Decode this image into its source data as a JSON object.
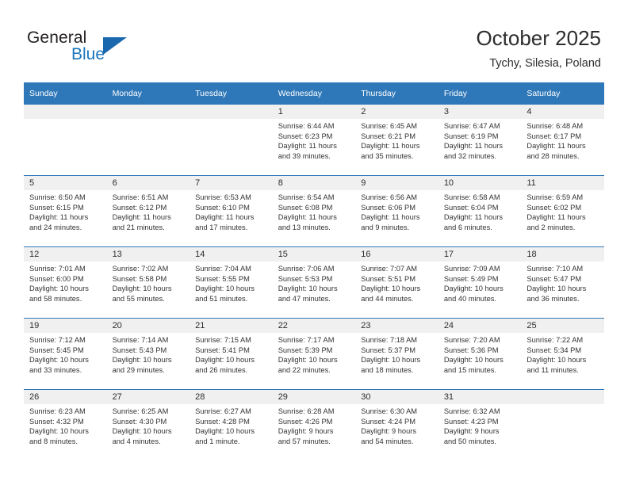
{
  "brand": {
    "word_one": "General",
    "word_two": "Blue",
    "triangle_color": "#1b68ae"
  },
  "header": {
    "title": "October 2025",
    "location": "Tychy, Silesia, Poland"
  },
  "theme": {
    "header_blue": "#2e77b8",
    "band_gray": "#f0f0f0",
    "text": "#333333"
  },
  "weekday_headers": [
    "Sunday",
    "Monday",
    "Tuesday",
    "Wednesday",
    "Thursday",
    "Friday",
    "Saturday"
  ],
  "weeks": [
    [
      {
        "day": "",
        "sunrise": "",
        "sunset": "",
        "daylight_1": "",
        "daylight_2": "",
        "empty": true
      },
      {
        "day": "",
        "sunrise": "",
        "sunset": "",
        "daylight_1": "",
        "daylight_2": "",
        "empty": true
      },
      {
        "day": "",
        "sunrise": "",
        "sunset": "",
        "daylight_1": "",
        "daylight_2": "",
        "empty": true
      },
      {
        "day": "1",
        "sunrise": "Sunrise: 6:44 AM",
        "sunset": "Sunset: 6:23 PM",
        "daylight_1": "Daylight: 11 hours",
        "daylight_2": "and 39 minutes."
      },
      {
        "day": "2",
        "sunrise": "Sunrise: 6:45 AM",
        "sunset": "Sunset: 6:21 PM",
        "daylight_1": "Daylight: 11 hours",
        "daylight_2": "and 35 minutes."
      },
      {
        "day": "3",
        "sunrise": "Sunrise: 6:47 AM",
        "sunset": "Sunset: 6:19 PM",
        "daylight_1": "Daylight: 11 hours",
        "daylight_2": "and 32 minutes."
      },
      {
        "day": "4",
        "sunrise": "Sunrise: 6:48 AM",
        "sunset": "Sunset: 6:17 PM",
        "daylight_1": "Daylight: 11 hours",
        "daylight_2": "and 28 minutes."
      }
    ],
    [
      {
        "day": "5",
        "sunrise": "Sunrise: 6:50 AM",
        "sunset": "Sunset: 6:15 PM",
        "daylight_1": "Daylight: 11 hours",
        "daylight_2": "and 24 minutes."
      },
      {
        "day": "6",
        "sunrise": "Sunrise: 6:51 AM",
        "sunset": "Sunset: 6:12 PM",
        "daylight_1": "Daylight: 11 hours",
        "daylight_2": "and 21 minutes."
      },
      {
        "day": "7",
        "sunrise": "Sunrise: 6:53 AM",
        "sunset": "Sunset: 6:10 PM",
        "daylight_1": "Daylight: 11 hours",
        "daylight_2": "and 17 minutes."
      },
      {
        "day": "8",
        "sunrise": "Sunrise: 6:54 AM",
        "sunset": "Sunset: 6:08 PM",
        "daylight_1": "Daylight: 11 hours",
        "daylight_2": "and 13 minutes."
      },
      {
        "day": "9",
        "sunrise": "Sunrise: 6:56 AM",
        "sunset": "Sunset: 6:06 PM",
        "daylight_1": "Daylight: 11 hours",
        "daylight_2": "and 9 minutes."
      },
      {
        "day": "10",
        "sunrise": "Sunrise: 6:58 AM",
        "sunset": "Sunset: 6:04 PM",
        "daylight_1": "Daylight: 11 hours",
        "daylight_2": "and 6 minutes."
      },
      {
        "day": "11",
        "sunrise": "Sunrise: 6:59 AM",
        "sunset": "Sunset: 6:02 PM",
        "daylight_1": "Daylight: 11 hours",
        "daylight_2": "and 2 minutes."
      }
    ],
    [
      {
        "day": "12",
        "sunrise": "Sunrise: 7:01 AM",
        "sunset": "Sunset: 6:00 PM",
        "daylight_1": "Daylight: 10 hours",
        "daylight_2": "and 58 minutes."
      },
      {
        "day": "13",
        "sunrise": "Sunrise: 7:02 AM",
        "sunset": "Sunset: 5:58 PM",
        "daylight_1": "Daylight: 10 hours",
        "daylight_2": "and 55 minutes."
      },
      {
        "day": "14",
        "sunrise": "Sunrise: 7:04 AM",
        "sunset": "Sunset: 5:55 PM",
        "daylight_1": "Daylight: 10 hours",
        "daylight_2": "and 51 minutes."
      },
      {
        "day": "15",
        "sunrise": "Sunrise: 7:06 AM",
        "sunset": "Sunset: 5:53 PM",
        "daylight_1": "Daylight: 10 hours",
        "daylight_2": "and 47 minutes."
      },
      {
        "day": "16",
        "sunrise": "Sunrise: 7:07 AM",
        "sunset": "Sunset: 5:51 PM",
        "daylight_1": "Daylight: 10 hours",
        "daylight_2": "and 44 minutes."
      },
      {
        "day": "17",
        "sunrise": "Sunrise: 7:09 AM",
        "sunset": "Sunset: 5:49 PM",
        "daylight_1": "Daylight: 10 hours",
        "daylight_2": "and 40 minutes."
      },
      {
        "day": "18",
        "sunrise": "Sunrise: 7:10 AM",
        "sunset": "Sunset: 5:47 PM",
        "daylight_1": "Daylight: 10 hours",
        "daylight_2": "and 36 minutes."
      }
    ],
    [
      {
        "day": "19",
        "sunrise": "Sunrise: 7:12 AM",
        "sunset": "Sunset: 5:45 PM",
        "daylight_1": "Daylight: 10 hours",
        "daylight_2": "and 33 minutes."
      },
      {
        "day": "20",
        "sunrise": "Sunrise: 7:14 AM",
        "sunset": "Sunset: 5:43 PM",
        "daylight_1": "Daylight: 10 hours",
        "daylight_2": "and 29 minutes."
      },
      {
        "day": "21",
        "sunrise": "Sunrise: 7:15 AM",
        "sunset": "Sunset: 5:41 PM",
        "daylight_1": "Daylight: 10 hours",
        "daylight_2": "and 26 minutes."
      },
      {
        "day": "22",
        "sunrise": "Sunrise: 7:17 AM",
        "sunset": "Sunset: 5:39 PM",
        "daylight_1": "Daylight: 10 hours",
        "daylight_2": "and 22 minutes."
      },
      {
        "day": "23",
        "sunrise": "Sunrise: 7:18 AM",
        "sunset": "Sunset: 5:37 PM",
        "daylight_1": "Daylight: 10 hours",
        "daylight_2": "and 18 minutes."
      },
      {
        "day": "24",
        "sunrise": "Sunrise: 7:20 AM",
        "sunset": "Sunset: 5:36 PM",
        "daylight_1": "Daylight: 10 hours",
        "daylight_2": "and 15 minutes."
      },
      {
        "day": "25",
        "sunrise": "Sunrise: 7:22 AM",
        "sunset": "Sunset: 5:34 PM",
        "daylight_1": "Daylight: 10 hours",
        "daylight_2": "and 11 minutes."
      }
    ],
    [
      {
        "day": "26",
        "sunrise": "Sunrise: 6:23 AM",
        "sunset": "Sunset: 4:32 PM",
        "daylight_1": "Daylight: 10 hours",
        "daylight_2": "and 8 minutes."
      },
      {
        "day": "27",
        "sunrise": "Sunrise: 6:25 AM",
        "sunset": "Sunset: 4:30 PM",
        "daylight_1": "Daylight: 10 hours",
        "daylight_2": "and 4 minutes."
      },
      {
        "day": "28",
        "sunrise": "Sunrise: 6:27 AM",
        "sunset": "Sunset: 4:28 PM",
        "daylight_1": "Daylight: 10 hours",
        "daylight_2": "and 1 minute."
      },
      {
        "day": "29",
        "sunrise": "Sunrise: 6:28 AM",
        "sunset": "Sunset: 4:26 PM",
        "daylight_1": "Daylight: 9 hours",
        "daylight_2": "and 57 minutes."
      },
      {
        "day": "30",
        "sunrise": "Sunrise: 6:30 AM",
        "sunset": "Sunset: 4:24 PM",
        "daylight_1": "Daylight: 9 hours",
        "daylight_2": "and 54 minutes."
      },
      {
        "day": "31",
        "sunrise": "Sunrise: 6:32 AM",
        "sunset": "Sunset: 4:23 PM",
        "daylight_1": "Daylight: 9 hours",
        "daylight_2": "and 50 minutes."
      },
      {
        "day": "",
        "sunrise": "",
        "sunset": "",
        "daylight_1": "",
        "daylight_2": "",
        "empty": true
      }
    ]
  ]
}
